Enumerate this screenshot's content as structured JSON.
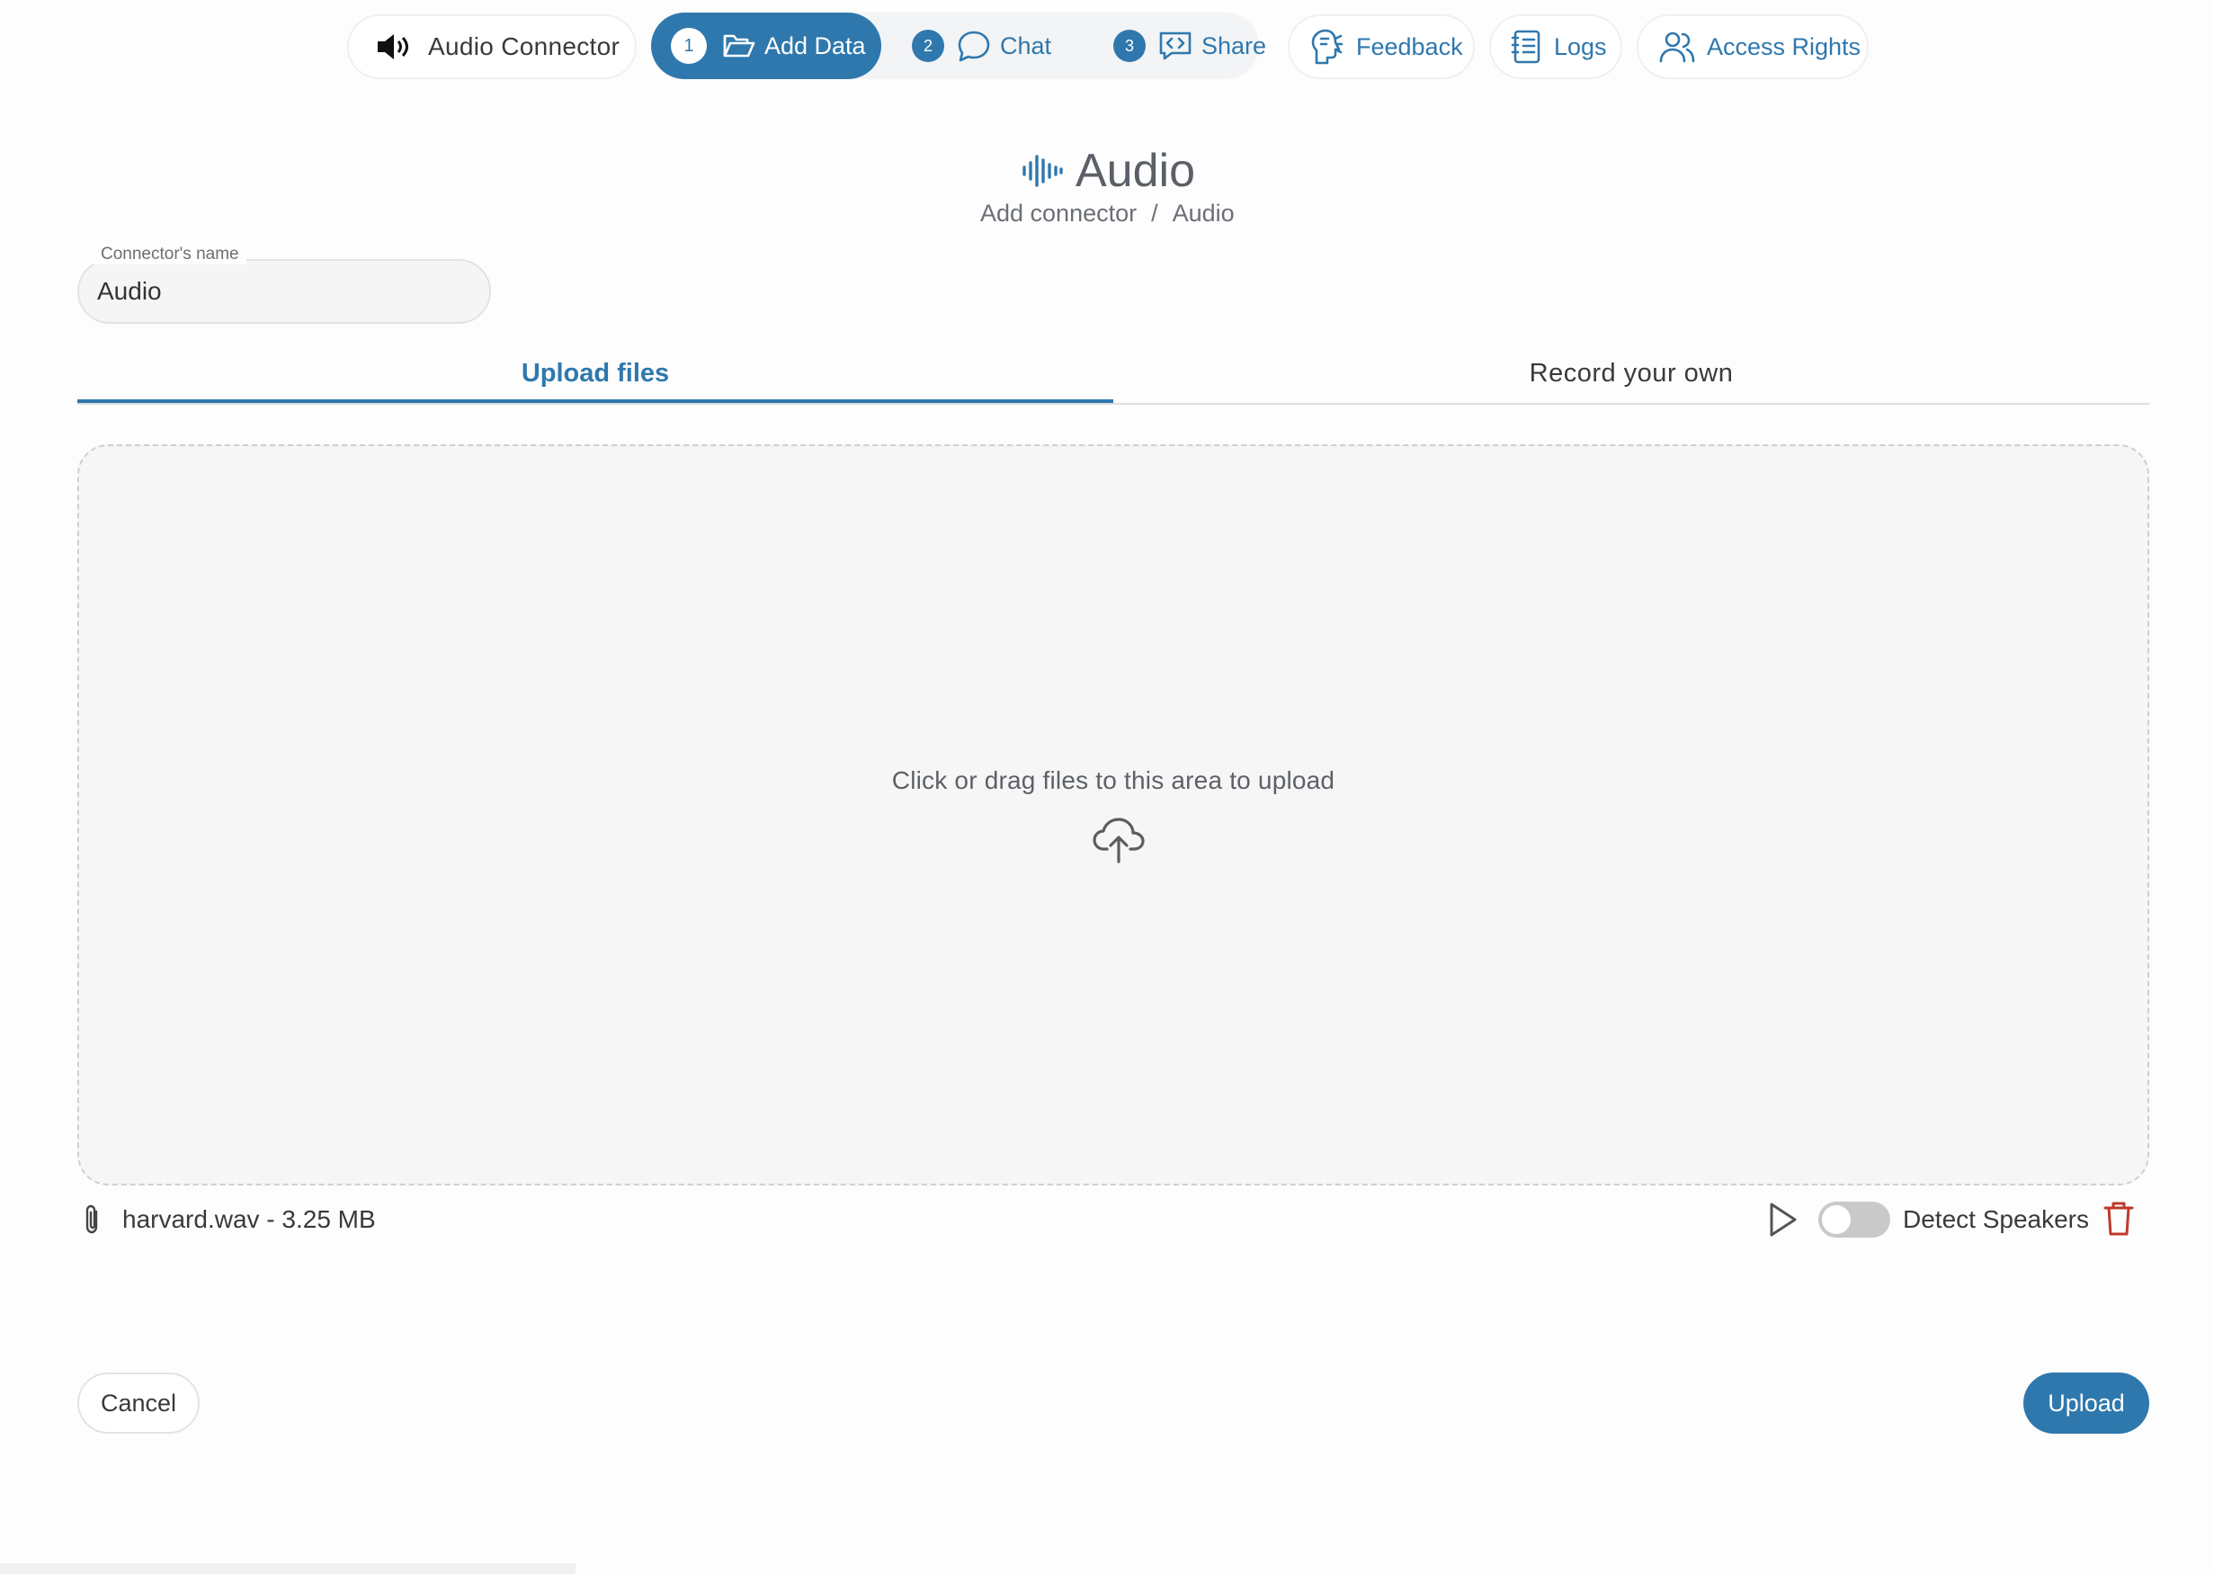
{
  "nav": {
    "connector_label": "Audio Connector",
    "steps": [
      {
        "num": "1",
        "label": "Add Data",
        "icon": "folder-icon",
        "active": true
      },
      {
        "num": "2",
        "label": "Chat",
        "icon": "chat-bubble-icon",
        "active": false
      },
      {
        "num": "3",
        "label": "Share",
        "icon": "share-code-icon",
        "active": false
      }
    ],
    "feedback_label": "Feedback",
    "logs_label": "Logs",
    "access_label": "Access Rights"
  },
  "header": {
    "title": "Audio",
    "breadcrumb": [
      "Add connector",
      "/",
      "Audio"
    ]
  },
  "form": {
    "name_label": "Connector's name",
    "name_value": "Audio"
  },
  "tabs": {
    "upload": "Upload files",
    "record": "Record your own",
    "active": "upload"
  },
  "dropzone": {
    "text": "Click or drag files to this area to upload"
  },
  "file": {
    "name": "harvard.wav - 3.25 MB",
    "detect_label": "Detect Speakers",
    "detect_on": false
  },
  "actions": {
    "cancel": "Cancel",
    "upload": "Upload"
  },
  "colors": {
    "accent": "#2f78ad",
    "danger": "#c0392b"
  }
}
